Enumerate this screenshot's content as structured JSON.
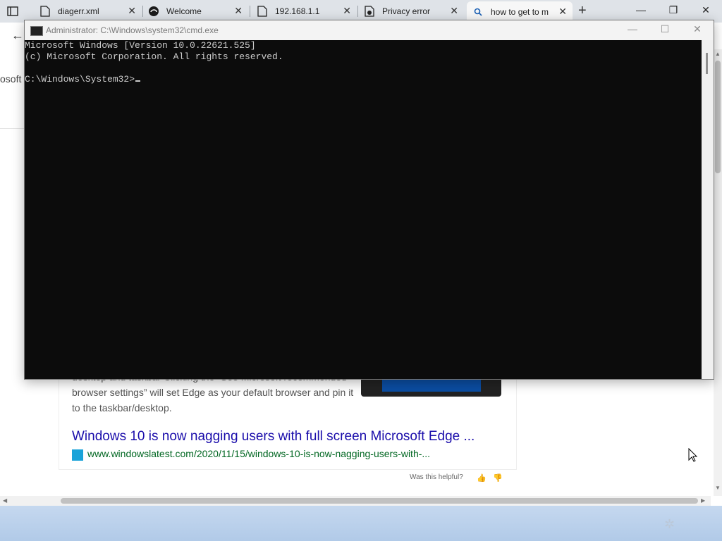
{
  "browser": {
    "tabs": [
      {
        "title": "diagerr.xml",
        "icon": "document-icon",
        "active": false
      },
      {
        "title": "Welcome",
        "icon": "edge-icon",
        "active": false
      },
      {
        "title": "192.168.1.1",
        "icon": "document-icon",
        "active": false
      },
      {
        "title": "Privacy error",
        "icon": "shield-error-icon",
        "active": false
      },
      {
        "title": "how to get to m",
        "icon": "search-icon",
        "active": true
      }
    ],
    "new_tab_label": "+",
    "window_controls": {
      "minimize": "—",
      "restore": "❐",
      "close": "✕"
    }
  },
  "page": {
    "fragment_text": "osoft",
    "snippet": "desktop and taskbar Clicking the “See Microsoft recommended browser settings” will set Edge as your default browser and pin it to the taskbar/desktop.",
    "result_title": "Windows 10 is now nagging users with full screen Microsoft Edge ...",
    "result_url": "www.windowslatest.com/2020/11/15/windows-10-is-now-nagging-users-with-...",
    "helpful_label": "Was this helpful?",
    "thumbs_up": "👍",
    "thumbs_down": "👎"
  },
  "cmd": {
    "title": "Administrator: C:\\Windows\\system32\\cmd.exe",
    "line1": "Microsoft Windows [Version 10.0.22621.525]",
    "line2": "(c) Microsoft Corporation. All rights reserved.",
    "prompt": "C:\\Windows\\System32>",
    "controls": {
      "minimize": "—",
      "maximize": "☐",
      "close": "✕"
    }
  },
  "colors": {
    "cmd_background": "#0c0c0c",
    "cmd_text": "#cccccc",
    "link_title": "#1a0dab",
    "link_url": "#006621"
  }
}
